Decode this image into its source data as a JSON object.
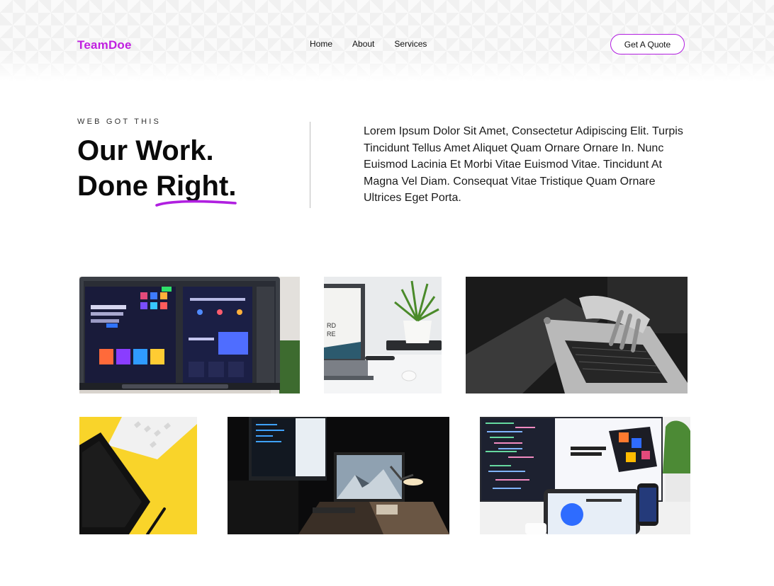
{
  "brand": {
    "name": "TeamDoe",
    "accent": "#c020e0"
  },
  "nav": {
    "items": [
      "Home",
      "About",
      "Services"
    ]
  },
  "header": {
    "cta_label": "Get A Quote"
  },
  "hero": {
    "eyebrow": "WEB GOT THIS",
    "title_line1": "Our Work.",
    "title_line2_prefix": "Done ",
    "title_line2_highlight": "Right",
    "title_line2_suffix": ".",
    "description": "Lorem Ipsum Dolor Sit Amet, Consectetur Adipiscing Elit. Turpis Tincidunt Tellus Amet Aliquet Quam Ornare Ornare In. Nunc Euismod Lacinia Et Morbi Vitae Euismod Vitae. Tincidunt At Magna Vel Diam. Consequat Vitae Tristique Quam Ornare Ultrices Eget Porta."
  },
  "gallery": {
    "photos": [
      {
        "subject": "Monitor displaying web design mockups"
      },
      {
        "subject": "Laptop with potted plant on desk"
      },
      {
        "subject": "Hands typing on laptop (black and white)"
      },
      {
        "subject": "Drawing tablet and keyboard on yellow background"
      },
      {
        "subject": "Dark desk setup with iMac and lamp"
      },
      {
        "subject": "Monitor with code and tablet, phone devices"
      }
    ]
  }
}
